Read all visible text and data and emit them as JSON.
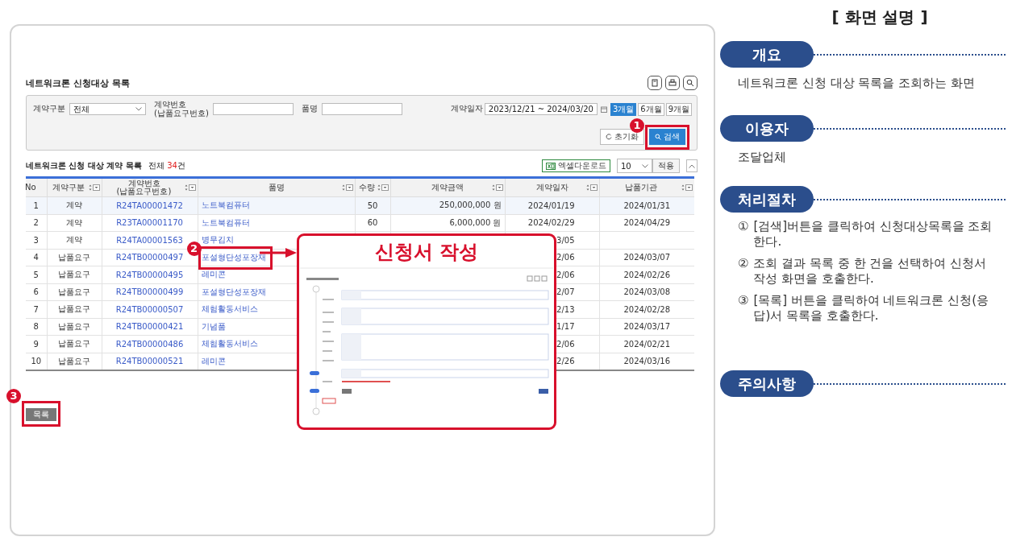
{
  "page": {
    "title": "네트워크론 신청대상 목록"
  },
  "search": {
    "fields": [
      {
        "kind": "select",
        "label": "계약구분",
        "value": "전체"
      },
      {
        "kind": "text",
        "label": "계약번호\n(납품요구번호)"
      },
      {
        "kind": "text",
        "label": "품명"
      },
      {
        "kind": "daterange",
        "label": "계약일자",
        "from": "2023/12/21",
        "separator": "~",
        "to": "2024/03/20"
      }
    ],
    "periods": [
      {
        "label": "3개월",
        "selected": true
      },
      {
        "label": "6개월",
        "selected": false
      },
      {
        "label": "9개월",
        "selected": false
      }
    ],
    "reset_button": "초기화",
    "search_button": "검색",
    "callout": "1"
  },
  "list": {
    "title": "네트워크론 신청 대상 계약 목록",
    "total_label": "전체",
    "total_count": "34",
    "total_unit": "건",
    "excel_button": "엑셀다운로드",
    "page_size": "10",
    "apply_button": "적용",
    "columns": [
      {
        "label": "No",
        "sortable": false
      },
      {
        "label": "계약구분",
        "sortable": true
      },
      {
        "label": "계약번호\n(납품요구번호)",
        "sortable": true
      },
      {
        "label": "품명",
        "sortable": true
      },
      {
        "label": "수량",
        "sortable": true
      },
      {
        "label": "계약금액",
        "sortable": true
      },
      {
        "label": "계약일자",
        "sortable": true
      },
      {
        "label": "납품기관",
        "sortable": true
      }
    ],
    "rows": [
      {
        "no": "1",
        "type": "계약",
        "contract_no": "R24TA00001472",
        "item": "노트북컴퓨터",
        "quantity": "50",
        "amount": "250,000,000 원",
        "date": "2024/01/19",
        "agency": "2024/01/31",
        "selected": true
      },
      {
        "no": "2",
        "type": "계약",
        "contract_no": "R23TA00001170",
        "item": "노트북컴퓨터",
        "quantity": "60",
        "amount": "6,000,000 원",
        "date": "2024/02/29",
        "agency": "2024/04/29",
        "selected": false
      },
      {
        "no": "3",
        "type": "계약",
        "contract_no": "R24TA00001563",
        "item": "병무김치",
        "date": "3/05",
        "selected": false
      },
      {
        "no": "4",
        "type": "납품요구",
        "contract_no": "R24TB00000497",
        "item": "포설형단성포장재",
        "date": "2/06",
        "agency": "2024/03/07",
        "selected": false,
        "callout": "2"
      },
      {
        "no": "5",
        "type": "납품요구",
        "contract_no": "R24TB00000495",
        "item": "레미콘",
        "date": "2/06",
        "agency": "2024/02/26",
        "selected": false
      },
      {
        "no": "6",
        "type": "납품요구",
        "contract_no": "R24TB00000499",
        "item": "포설형단성포장재",
        "date": "2/07",
        "agency": "2024/03/08",
        "selected": false
      },
      {
        "no": "7",
        "type": "납품요구",
        "contract_no": "R24TB00000507",
        "item": "체험활동서비스",
        "date": "2/13",
        "agency": "2024/02/28",
        "selected": false
      },
      {
        "no": "8",
        "type": "납품요구",
        "contract_no": "R24TB00000421",
        "item": "기념품",
        "date": "1/17",
        "agency": "2024/03/17",
        "selected": false
      },
      {
        "no": "9",
        "type": "납품요구",
        "contract_no": "R24TB00000486",
        "item": "체험활동서비스",
        "date": "2/06",
        "agency": "2024/02/21",
        "selected": false
      },
      {
        "no": "10",
        "type": "납품요구",
        "contract_no": "R24TB00000521",
        "item": "레미콘",
        "date": "2/26",
        "agency": "2024/03/16",
        "selected": false
      }
    ]
  },
  "list_button": {
    "label": "목록",
    "callout": "3"
  },
  "popup": {
    "title": "신청서 작성"
  },
  "description": {
    "title": "[ 화면 설명 ]",
    "sections": [
      {
        "heading": "개요",
        "lines": [
          "네트워크론 신청 대상 목록을 조회하는 화면"
        ]
      },
      {
        "heading": "이용자",
        "lines": [
          "조달업체"
        ]
      },
      {
        "heading": "처리절차",
        "steps": [
          {
            "marker": "①",
            "text": "[검색]버튼을 클릭하여 신청대상목록을 조회한다."
          },
          {
            "marker": "②",
            "text": "조회 결과 목록 중 한 건을 선택하여 신청서 작성 화면을 호출한다."
          },
          {
            "marker": "③",
            "text": "[목록] 버튼을 클릭하여 네트워크론 신청(응답)서 목록을 호출한다."
          }
        ]
      },
      {
        "heading": "주의사항"
      }
    ]
  }
}
